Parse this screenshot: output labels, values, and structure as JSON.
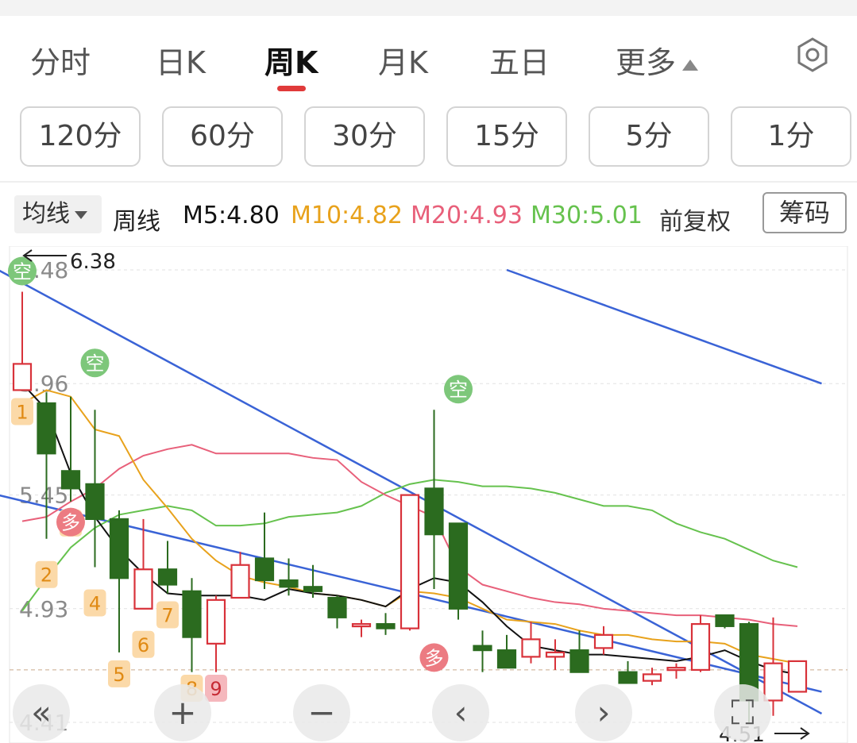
{
  "tabs": [
    {
      "label": "分时",
      "active": false
    },
    {
      "label": "日K",
      "active": false
    },
    {
      "label": "周K",
      "active": true
    },
    {
      "label": "月K",
      "active": false
    },
    {
      "label": "五日",
      "active": false
    },
    {
      "label": "更多",
      "active": false
    }
  ],
  "intervals": [
    "120分",
    "60分",
    "30分",
    "15分",
    "5分",
    "1分"
  ],
  "ma_bar": {
    "average_selector": "均线",
    "period_label": "周线",
    "m5": "M5:4.80",
    "m10": "M10:4.82",
    "m20": "M20:4.93",
    "m30": "M30:5.01",
    "adjust": "前复权",
    "chips_button": "筹码"
  },
  "colors": {
    "up": "#d8323a",
    "down": "#2b6b1f",
    "m5": "#111111",
    "m10": "#e8a21c",
    "m20": "#e8607a",
    "m30": "#66c24e",
    "trend": "#3a63d6",
    "tab_accent": "#e03a3a"
  },
  "chart_data": {
    "type": "candlestick",
    "price_labels": [
      "6.48",
      "5.96",
      "5.45",
      "4.93",
      "4.41"
    ],
    "high_marker": "6.38",
    "low_marker": "4.51",
    "last_close_ref": 4.51,
    "candles": [
      {
        "o": 5.93,
        "h": 6.38,
        "l": 5.95,
        "c": 6.05
      },
      {
        "o": 5.87,
        "h": 5.92,
        "l": 5.25,
        "c": 5.64
      },
      {
        "o": 5.56,
        "h": 5.9,
        "l": 5.42,
        "c": 5.48
      },
      {
        "o": 5.5,
        "h": 5.84,
        "l": 5.12,
        "c": 5.34
      },
      {
        "o": 5.34,
        "h": 5.38,
        "l": 4.73,
        "c": 5.07
      },
      {
        "o": 4.93,
        "h": 5.34,
        "l": 4.93,
        "c": 5.11
      },
      {
        "o": 5.11,
        "h": 5.24,
        "l": 5.0,
        "c": 5.04
      },
      {
        "o": 5.01,
        "h": 5.07,
        "l": 4.64,
        "c": 4.8
      },
      {
        "o": 4.77,
        "h": 4.99,
        "l": 4.64,
        "c": 4.97
      },
      {
        "o": 4.98,
        "h": 5.19,
        "l": 4.99,
        "c": 5.13
      },
      {
        "o": 5.16,
        "h": 5.37,
        "l": 5.02,
        "c": 5.06
      },
      {
        "o": 5.06,
        "h": 5.16,
        "l": 4.99,
        "c": 5.03
      },
      {
        "o": 5.03,
        "h": 5.13,
        "l": 4.98,
        "c": 5.01
      },
      {
        "o": 4.98,
        "h": 4.99,
        "l": 4.84,
        "c": 4.89
      },
      {
        "o": 4.85,
        "h": 4.88,
        "l": 4.8,
        "c": 4.86
      },
      {
        "o": 4.86,
        "h": 4.91,
        "l": 4.81,
        "c": 4.84
      },
      {
        "o": 4.84,
        "h": 5.45,
        "l": 4.83,
        "c": 5.45
      },
      {
        "o": 5.48,
        "h": 5.84,
        "l": 5.02,
        "c": 5.27
      },
      {
        "o": 5.32,
        "h": 5.28,
        "l": 4.88,
        "c": 4.93
      },
      {
        "o": 4.76,
        "h": 4.83,
        "l": 4.64,
        "c": 4.74
      },
      {
        "o": 4.74,
        "h": 4.81,
        "l": 4.69,
        "c": 4.66
      },
      {
        "o": 4.71,
        "h": 4.87,
        "l": 4.68,
        "c": 4.79
      },
      {
        "o": 4.71,
        "h": 4.79,
        "l": 4.65,
        "c": 4.73
      },
      {
        "o": 4.74,
        "h": 4.83,
        "l": 4.74,
        "c": 4.64
      },
      {
        "o": 4.75,
        "h": 4.85,
        "l": 4.72,
        "c": 4.81
      },
      {
        "o": 4.64,
        "h": 4.69,
        "l": 4.59,
        "c": 4.59
      },
      {
        "o": 4.6,
        "h": 4.66,
        "l": 4.58,
        "c": 4.63
      },
      {
        "o": 4.66,
        "h": 4.68,
        "l": 4.61,
        "c": 4.66
      },
      {
        "o": 4.65,
        "h": 4.9,
        "l": 4.64,
        "c": 4.86
      },
      {
        "o": 4.9,
        "h": 4.9,
        "l": 4.84,
        "c": 4.85
      },
      {
        "o": 4.86,
        "h": 4.87,
        "l": 4.41,
        "c": 4.51
      },
      {
        "o": 4.51,
        "h": 4.89,
        "l": 4.44,
        "c": 4.68
      },
      {
        "o": 4.55,
        "h": 4.69,
        "l": 4.58,
        "c": 4.69
      }
    ],
    "ma5": [
      5.96,
      5.84,
      5.55,
      5.35,
      5.2,
      5.09,
      5.0,
      4.99,
      4.99,
      4.99,
      4.97,
      5.02,
      5.0,
      4.99,
      4.97,
      4.94,
      5.02,
      5.07,
      5.05,
      4.96,
      4.85,
      4.76,
      4.74,
      4.72,
      4.72,
      4.71,
      4.7,
      4.69,
      4.71,
      4.74,
      4.69,
      4.65,
      4.63
    ],
    "ma10": [
      5.87,
      5.93,
      5.9,
      5.75,
      5.72,
      5.52,
      5.39,
      5.25,
      5.15,
      5.08,
      5.05,
      5.03,
      5.0,
      4.99,
      4.97,
      4.94,
      5.01,
      5.0,
      4.98,
      4.93,
      4.88,
      4.87,
      4.86,
      4.83,
      4.81,
      4.81,
      4.79,
      4.78,
      4.78,
      4.77,
      4.72,
      4.7,
      4.68
    ],
    "ma20": [
      5.33,
      5.35,
      5.42,
      5.48,
      5.57,
      5.63,
      5.66,
      5.68,
      5.64,
      5.64,
      5.64,
      5.64,
      5.62,
      5.61,
      5.51,
      5.45,
      5.4,
      5.35,
      5.12,
      5.04,
      5.01,
      4.98,
      4.96,
      4.95,
      4.93,
      4.92,
      4.91,
      4.9,
      4.9,
      4.89,
      4.88,
      4.86,
      4.85
    ],
    "ma30": [
      4.92,
      5.07,
      5.21,
      5.3,
      5.36,
      5.38,
      5.4,
      5.38,
      5.31,
      5.31,
      5.32,
      5.35,
      5.36,
      5.37,
      5.4,
      5.46,
      5.5,
      5.52,
      5.51,
      5.49,
      5.49,
      5.48,
      5.46,
      5.43,
      5.4,
      5.4,
      5.38,
      5.32,
      5.28,
      5.25,
      5.2,
      5.15,
      5.12
    ],
    "trendlines": [
      {
        "from": [
          -1,
          6.48
        ],
        "to": [
          33,
          4.45
        ]
      },
      {
        "from": [
          -1,
          5.45
        ],
        "to": [
          33,
          4.55
        ]
      },
      {
        "from": [
          20,
          6.48
        ],
        "to": [
          33,
          5.96
        ]
      }
    ],
    "signals": [
      {
        "text": "空",
        "index": 0,
        "price": 6.38,
        "color": "green"
      },
      {
        "text": "空",
        "index": 3,
        "price": 5.96,
        "color": "green"
      },
      {
        "text": "空",
        "index": 18,
        "price": 5.84,
        "color": "green"
      },
      {
        "text": "多",
        "index": 2,
        "price": 5.45,
        "color": "red"
      },
      {
        "text": "多",
        "index": 17,
        "price": 4.83,
        "color": "red"
      }
    ],
    "sequence_labels": [
      {
        "text": "1",
        "index": 0
      },
      {
        "text": "2",
        "index": 1
      },
      {
        "text": "3",
        "index": 2
      },
      {
        "text": "4",
        "index": 3
      },
      {
        "text": "5",
        "index": 4
      },
      {
        "text": "6",
        "index": 5
      },
      {
        "text": "7",
        "index": 6
      },
      {
        "text": "8",
        "index": 7
      },
      {
        "text": "9",
        "index": 8
      }
    ],
    "ylim": [
      4.41,
      6.48
    ]
  },
  "nav_buttons": [
    {
      "name": "rewind-button",
      "glyph": "«"
    },
    {
      "name": "zoom-in-button",
      "glyph": "+"
    },
    {
      "name": "zoom-out-button",
      "glyph": "−"
    },
    {
      "name": "prev-button",
      "glyph": "‹"
    },
    {
      "name": "next-button",
      "glyph": "›"
    },
    {
      "name": "fullscreen-button",
      "glyph": "⛶"
    }
  ]
}
